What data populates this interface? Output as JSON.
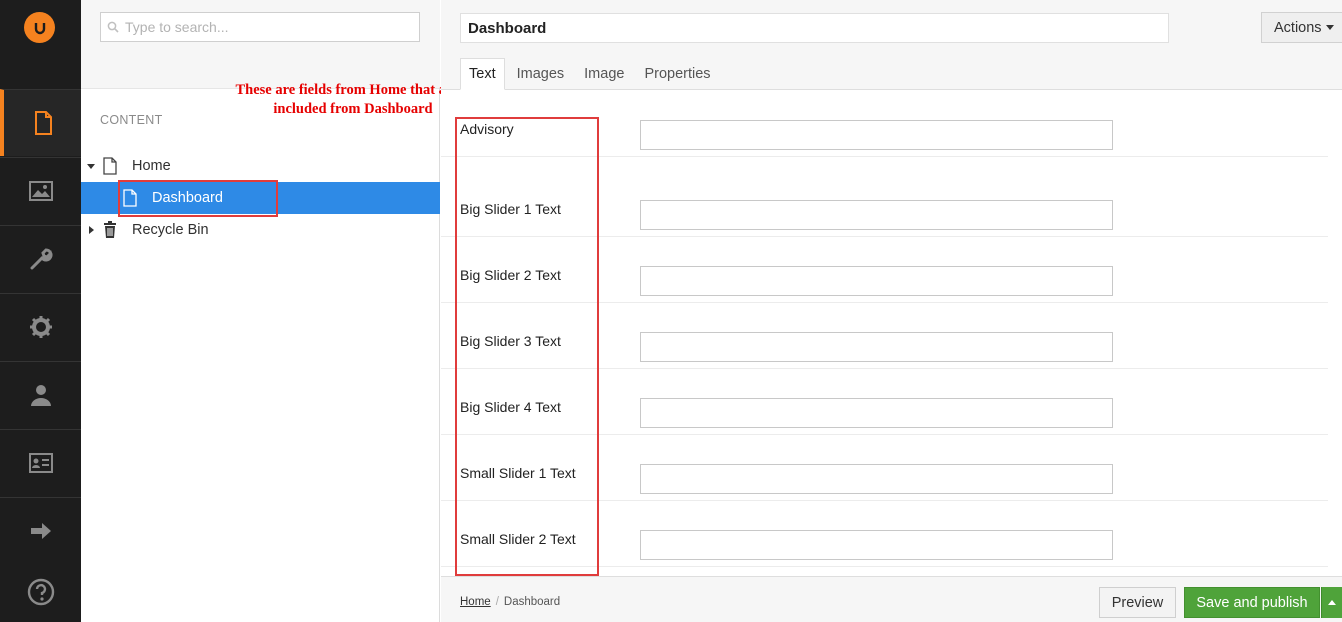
{
  "colors": {
    "accent": "#f5821f",
    "selected": "#2e8ae6",
    "publish": "#4fa33a",
    "annotation": "#e60000"
  },
  "appbar": {
    "logo_icon": "umbraco-logo-icon",
    "sections": [
      "content-icon",
      "media-icon",
      "wrench-icon",
      "gear-icon",
      "user-icon",
      "members-icon",
      "arrow-right-icon"
    ],
    "help_icon": "help-icon"
  },
  "tree": {
    "search_placeholder": "Type to search...",
    "section_title": "CONTENT",
    "nodes": [
      {
        "label": "Home",
        "icon": "document-icon",
        "expanded": true
      },
      {
        "label": "Dashboard",
        "icon": "document-icon",
        "selected": true
      },
      {
        "label": "Recycle Bin",
        "icon": "trash-icon",
        "expanded": false
      }
    ]
  },
  "annotation": {
    "line1": "These are fields from Home that are",
    "line2": "included from Dashboard"
  },
  "editor": {
    "name_value": "Dashboard",
    "actions_label": "Actions",
    "tabs": [
      "Text",
      "Images",
      "Image",
      "Properties"
    ],
    "properties": [
      {
        "label": "Advisory",
        "value": ""
      },
      {
        "label": "Big Slider 1 Text",
        "value": ""
      },
      {
        "label": "Big Slider 2 Text",
        "value": ""
      },
      {
        "label": "Big Slider 3 Text",
        "value": ""
      },
      {
        "label": "Big Slider 4 Text",
        "value": ""
      },
      {
        "label": "Small Slider 1 Text",
        "value": ""
      },
      {
        "label": "Small Slider 2 Text",
        "value": ""
      }
    ]
  },
  "footer": {
    "breadcrumb": [
      "Home",
      "Dashboard"
    ],
    "preview_label": "Preview",
    "publish_label": "Save and publish"
  }
}
